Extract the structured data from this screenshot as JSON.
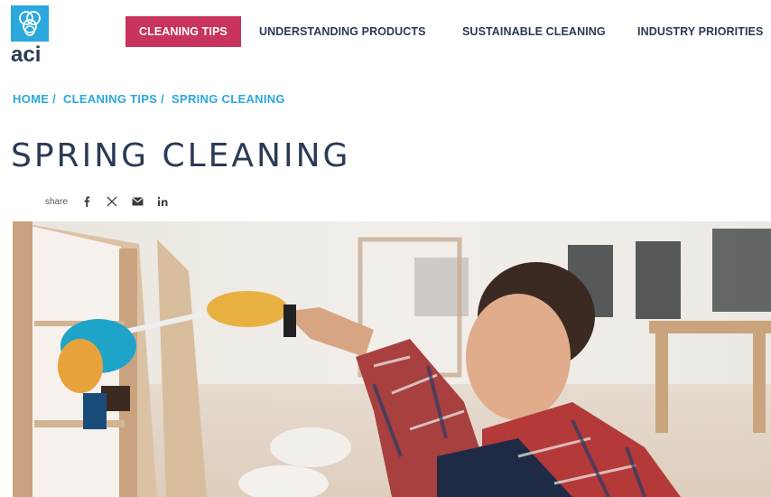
{
  "logo": {
    "text": "aci"
  },
  "nav": {
    "items": [
      {
        "label": "CLEANING TIPS",
        "active": true
      },
      {
        "label": "UNDERSTANDING PRODUCTS",
        "active": false
      },
      {
        "label": "SUSTAINABLE CLEANING",
        "active": false
      },
      {
        "label": "INDUSTRY PRIORITIES",
        "active": false
      }
    ]
  },
  "breadcrumb": {
    "home": "HOME /",
    "section": "CLEANING TIPS /",
    "current": "SPRING CLEANING"
  },
  "page": {
    "title": "SPRING CLEANING"
  },
  "share": {
    "label": "share",
    "icons": [
      "facebook-icon",
      "x-icon",
      "mail-icon",
      "linkedin-icon"
    ]
  },
  "colors": {
    "brand_blue": "#2ba8dd",
    "nav_active": "#c8345b",
    "text_dark": "#2b3a55"
  }
}
